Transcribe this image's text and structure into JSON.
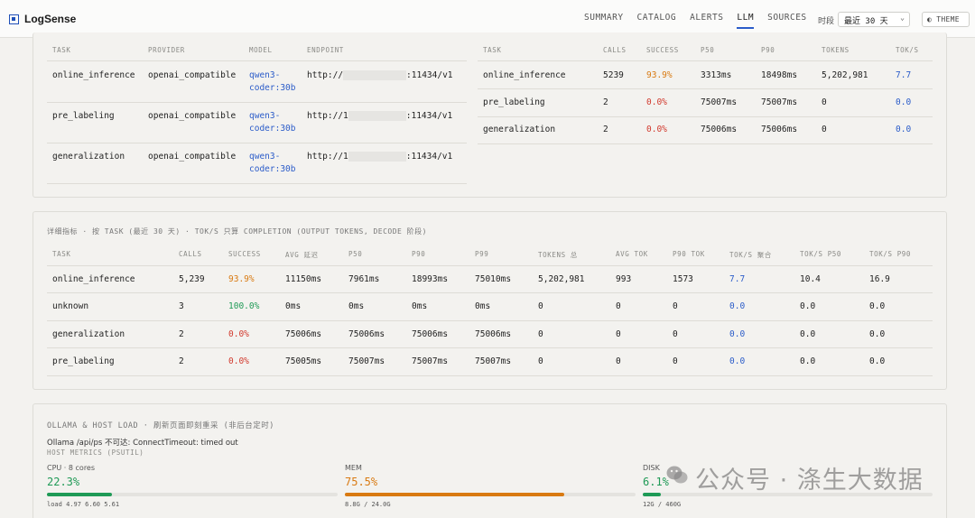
{
  "app": {
    "name": "LogSense"
  },
  "nav": {
    "items": [
      "SUMMARY",
      "CATALOG",
      "ALERTS",
      "LLM",
      "SOURCES"
    ],
    "active": "LLM",
    "period_label": "时段",
    "period_value": "最近 30 天",
    "theme_label": "◐ THEME"
  },
  "providers": {
    "headers": [
      "TASK",
      "PROVIDER",
      "MODEL",
      "ENDPOINT"
    ],
    "rows": [
      {
        "task": "online_inference",
        "provider": "openai_compatible",
        "model_a": "qwen3-",
        "model_b": "coder:30b",
        "ep_a": "http://",
        "ep_b": ":11434/v1"
      },
      {
        "task": "pre_labeling",
        "provider": "openai_compatible",
        "model_a": "qwen3-",
        "model_b": "coder:30b",
        "ep_a": "http://1",
        "ep_b": ":11434/v1"
      },
      {
        "task": "generalization",
        "provider": "openai_compatible",
        "model_a": "qwen3-",
        "model_b": "coder:30b",
        "ep_a": "http://1",
        "ep_b": ":11434/v1"
      }
    ]
  },
  "summary": {
    "headers": [
      "TASK",
      "CALLS",
      "SUCCESS",
      "P50",
      "P90",
      "TOKENS",
      "TOK/S"
    ],
    "rows": [
      {
        "task": "online_inference",
        "calls": "5239",
        "success": "93.9%",
        "p50": "3313ms",
        "p90": "18498ms",
        "tokens": "5,202,981",
        "toks": "7.7"
      },
      {
        "task": "pre_labeling",
        "calls": "2",
        "success": "0.0%",
        "p50": "75007ms",
        "p90": "75007ms",
        "tokens": "0",
        "toks": "0.0"
      },
      {
        "task": "generalization",
        "calls": "2",
        "success": "0.0%",
        "p50": "75006ms",
        "p90": "75006ms",
        "tokens": "0",
        "toks": "0.0"
      }
    ]
  },
  "detail": {
    "title": "详细指标 · 按 TASK (最近 30 天) · TOK/S 只算 COMPLETION (OUTPUT TOKENS, DECODE 阶段)",
    "headers": [
      "TASK",
      "CALLS",
      "SUCCESS",
      "AVG 延迟",
      "P50",
      "P90",
      "P99",
      "TOKENS 总",
      "AVG TOK",
      "P90 TOK",
      "TOK/S 聚合",
      "TOK/S P50",
      "TOK/S P90"
    ],
    "rows": [
      [
        "online_inference",
        "5,239",
        "93.9%",
        "11150ms",
        "7961ms",
        "18993ms",
        "75010ms",
        "5,202,981",
        "993",
        "1573",
        "7.7",
        "10.4",
        "16.9"
      ],
      [
        "unknown",
        "3",
        "100.0%",
        "0ms",
        "0ms",
        "0ms",
        "0ms",
        "0",
        "0",
        "0",
        "0.0",
        "0.0",
        "0.0"
      ],
      [
        "generalization",
        "2",
        "0.0%",
        "75006ms",
        "75006ms",
        "75006ms",
        "75006ms",
        "0",
        "0",
        "0",
        "0.0",
        "0.0",
        "0.0"
      ],
      [
        "pre_labeling",
        "2",
        "0.0%",
        "75005ms",
        "75007ms",
        "75007ms",
        "75007ms",
        "0",
        "0",
        "0",
        "0.0",
        "0.0",
        "0.0"
      ]
    ]
  },
  "host": {
    "title": "OLLAMA & HOST LOAD · 刷新页面即刻重采 (非后台定时)",
    "ollama_status": "Ollama /api/ps 不可达: ConnectTimeout: timed out",
    "metrics_title": "HOST METRICS (PSUTIL)",
    "cpu": {
      "label": "CPU · 8 cores",
      "value": "22.3%",
      "fraction": 0.223,
      "sub": "load 4.97 6.60 5.61",
      "color": "#1f9a56"
    },
    "mem": {
      "label": "MEM",
      "value": "75.5%",
      "fraction": 0.755,
      "sub": "8.8G / 24.0G",
      "color": "#d97a12"
    },
    "disk": {
      "label": "DISK",
      "value": "6.1%",
      "fraction": 0.061,
      "sub": "12G / 460G",
      "color": "#1f9a56"
    }
  },
  "watermark": "公众号 · 涤生大数据",
  "colors": {
    "accent": "#2b5cc9",
    "success": "#1f9a56",
    "warning": "#d97a12",
    "danger": "#d23a2e"
  }
}
